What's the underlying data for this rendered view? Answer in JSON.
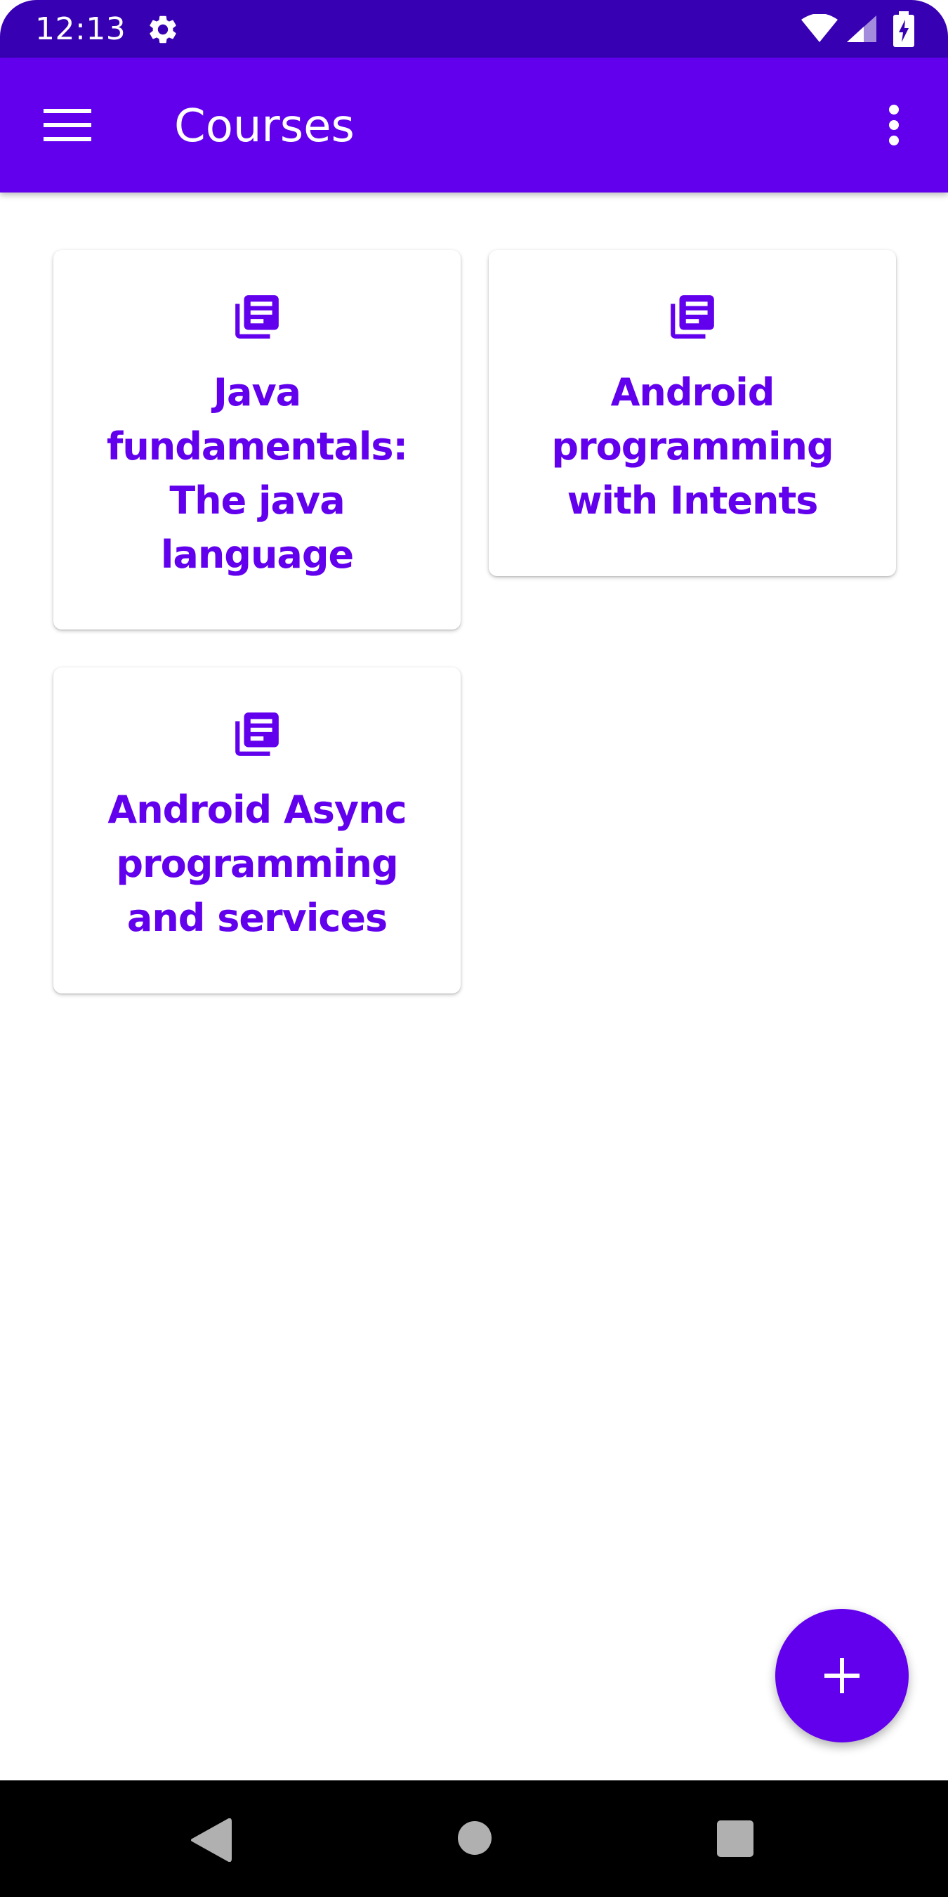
{
  "status_bar": {
    "time": "12:13",
    "icons": [
      "gear-icon",
      "wifi-icon",
      "signal-icon",
      "battery-icon"
    ]
  },
  "app_bar": {
    "title": "Courses",
    "menu_icon": "menu-icon",
    "overflow_icon": "more-vert-icon"
  },
  "courses": [
    {
      "title": "Java fundamentals: The java language",
      "icon": "library-books-icon"
    },
    {
      "title": "Android programming with Intents",
      "icon": "library-books-icon"
    },
    {
      "title": "Android Async programming and services",
      "icon": "library-books-icon"
    }
  ],
  "fab": {
    "icon": "add-icon"
  },
  "nav_bar": {
    "icons": [
      "back-icon",
      "home-icon",
      "recents-icon"
    ]
  },
  "colors": {
    "primary": "#6200ee",
    "primary_dark": "#3700b3",
    "card_text": "#6200ee",
    "background": "#ffffff",
    "nav_bar": "#000000"
  }
}
